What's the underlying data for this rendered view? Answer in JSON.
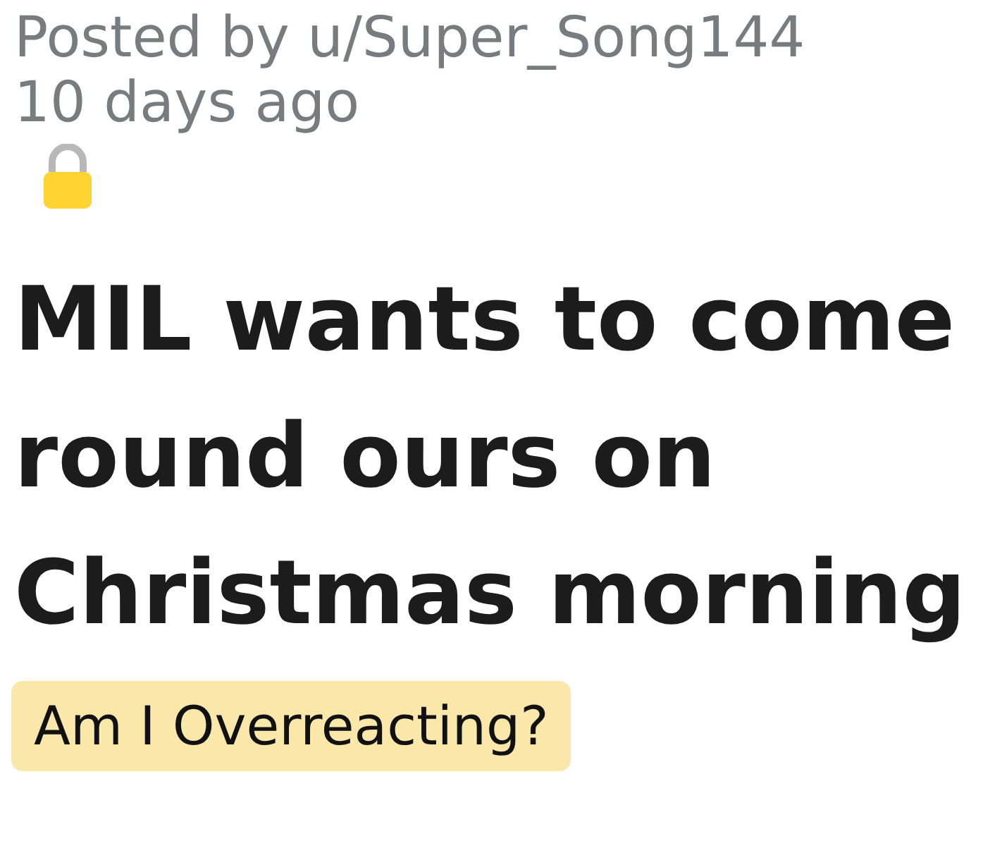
{
  "post": {
    "posted_by": "Posted by u/Super_Song144",
    "age": "10 days ago",
    "locked": true,
    "title": "MIL wants to come round ours on Christmas morning",
    "flair": {
      "text": "Am I Overreacting?",
      "color": "#f9e8a9"
    }
  }
}
